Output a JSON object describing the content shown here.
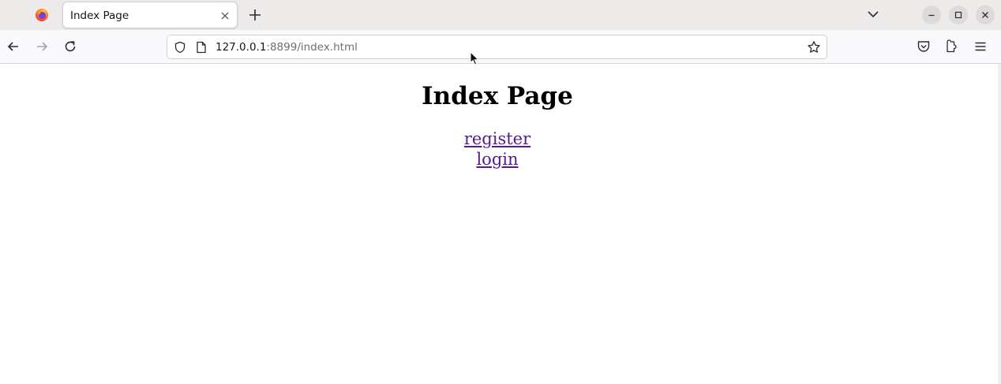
{
  "tab": {
    "title": "Index Page"
  },
  "urlbar": {
    "host": "127.0.0.1",
    "path": ":8899/index.html"
  },
  "page": {
    "heading": "Index Page",
    "links": [
      {
        "label": "register"
      },
      {
        "label": "login"
      }
    ]
  },
  "icons": {
    "browser_logo": "firefox-logo-icon",
    "tab_close": "close-icon",
    "new_tab": "plus-icon",
    "tab_list": "chevron-down-icon",
    "minimize": "minimize-icon",
    "maximize": "maximize-icon",
    "close_window": "close-icon",
    "back": "arrow-left-icon",
    "forward": "arrow-right-icon",
    "reload": "reload-icon",
    "tracking": "shield-icon",
    "page_info": "page-icon",
    "bookmark": "star-icon",
    "pocket": "pocket-icon",
    "extensions": "puzzle-icon",
    "menu": "hamburger-icon"
  },
  "colors": {
    "visited_link": "#551a8b",
    "tabstrip_bg": "#ecebea",
    "toolbar_bg": "#f9f9fb"
  }
}
